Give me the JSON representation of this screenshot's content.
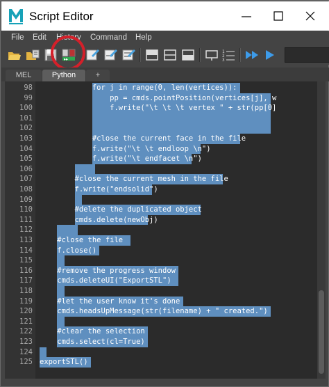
{
  "window": {
    "title": "Script Editor",
    "app_icon": "maya-logo-icon"
  },
  "menu": [
    "File",
    "Edit",
    "History",
    "Command",
    "Help"
  ],
  "tabs": [
    {
      "label": "MEL",
      "active": false
    },
    {
      "label": "Python",
      "active": true
    },
    {
      "label": "+",
      "active": false
    }
  ],
  "toolbar": {
    "icons": [
      "open-script-icon",
      "source-script-icon",
      "save-script-icon",
      "save-script-to-shelf-icon",
      "clear-history-icon",
      "clear-input-icon",
      "clear-all-icon",
      "show-history-only-icon",
      "show-input-only-icon",
      "show-both-icon",
      "echo-all-commands-icon",
      "show-line-numbers-icon",
      "execute-all-icon",
      "execute-selected-icon"
    ],
    "highlight_color": "#d4202a"
  },
  "editor": {
    "selection_color": "#5f8fbf",
    "lines": [
      {
        "num": "98",
        "text": "            for j in range(0, len(vertices)):",
        "sel": [
          12,
          45
        ]
      },
      {
        "num": "99",
        "text": "                pp = cmds.pointPosition(vertices[j], w",
        "sel": [
          12,
          52
        ]
      },
      {
        "num": "100",
        "text": "                f.write(\"\\t \\t \\t vertex \" + str(pp[0]",
        "sel": [
          12,
          52
        ]
      },
      {
        "num": "101",
        "text": "",
        "sel": [
          12,
          52
        ]
      },
      {
        "num": "102",
        "text": "",
        "sel": [
          12,
          52
        ]
      },
      {
        "num": "103",
        "text": "            #close the current face in the file",
        "sel": [
          12,
          45
        ]
      },
      {
        "num": "104",
        "text": "            f.write(\"\\t \\t endloop \\n\")",
        "sel": [
          12,
          36
        ]
      },
      {
        "num": "105",
        "text": "            f.write(\"\\t endfacet \\n\")",
        "sel": [
          12,
          34
        ]
      },
      {
        "num": "106",
        "text": "",
        "sel": [
          8,
          12
        ]
      },
      {
        "num": "107",
        "text": "        #close the current mesh in the file",
        "sel": [
          8,
          41
        ]
      },
      {
        "num": "108",
        "text": "        f.write(\"endsolid\")",
        "sel": [
          8,
          25
        ]
      },
      {
        "num": "109",
        "text": "",
        "sel": [
          8,
          9
        ]
      },
      {
        "num": "110",
        "text": "        #delete the duplicated object",
        "sel": [
          8,
          36
        ]
      },
      {
        "num": "111",
        "text": "        cmds.delete(newObj)",
        "sel": [
          8,
          24
        ]
      },
      {
        "num": "112",
        "text": "",
        "sel": [
          4,
          8
        ]
      },
      {
        "num": "113",
        "text": "    #close the file ",
        "sel": [
          4,
          20
        ]
      },
      {
        "num": "114",
        "text": "    f.close()",
        "sel": [
          4,
          13
        ]
      },
      {
        "num": "115",
        "text": "",
        "sel": [
          4,
          5
        ]
      },
      {
        "num": "116",
        "text": "    #remove the progress window",
        "sel": [
          4,
          31
        ]
      },
      {
        "num": "117",
        "text": "    cmds.deleteUI(\"ExportSTL\")",
        "sel": [
          4,
          31
        ]
      },
      {
        "num": "118",
        "text": "",
        "sel": [
          4,
          5
        ]
      },
      {
        "num": "119",
        "text": "    #let the user know it's done",
        "sel": [
          4,
          32
        ]
      },
      {
        "num": "120",
        "text": "    cmds.headsUpMessage(str(filename) + \" created.\")",
        "sel": [
          4,
          52
        ]
      },
      {
        "num": "121",
        "text": "",
        "sel": [
          4,
          5
        ]
      },
      {
        "num": "122",
        "text": "    #clear the selection",
        "sel": [
          4,
          24
        ]
      },
      {
        "num": "123",
        "text": "    cmds.select(cl=True)",
        "sel": [
          4,
          24
        ]
      },
      {
        "num": "124",
        "text": "",
        "sel": [
          0,
          1
        ]
      },
      {
        "num": "125",
        "text": "exportSTL()",
        "sel": [
          0,
          11
        ]
      }
    ]
  }
}
